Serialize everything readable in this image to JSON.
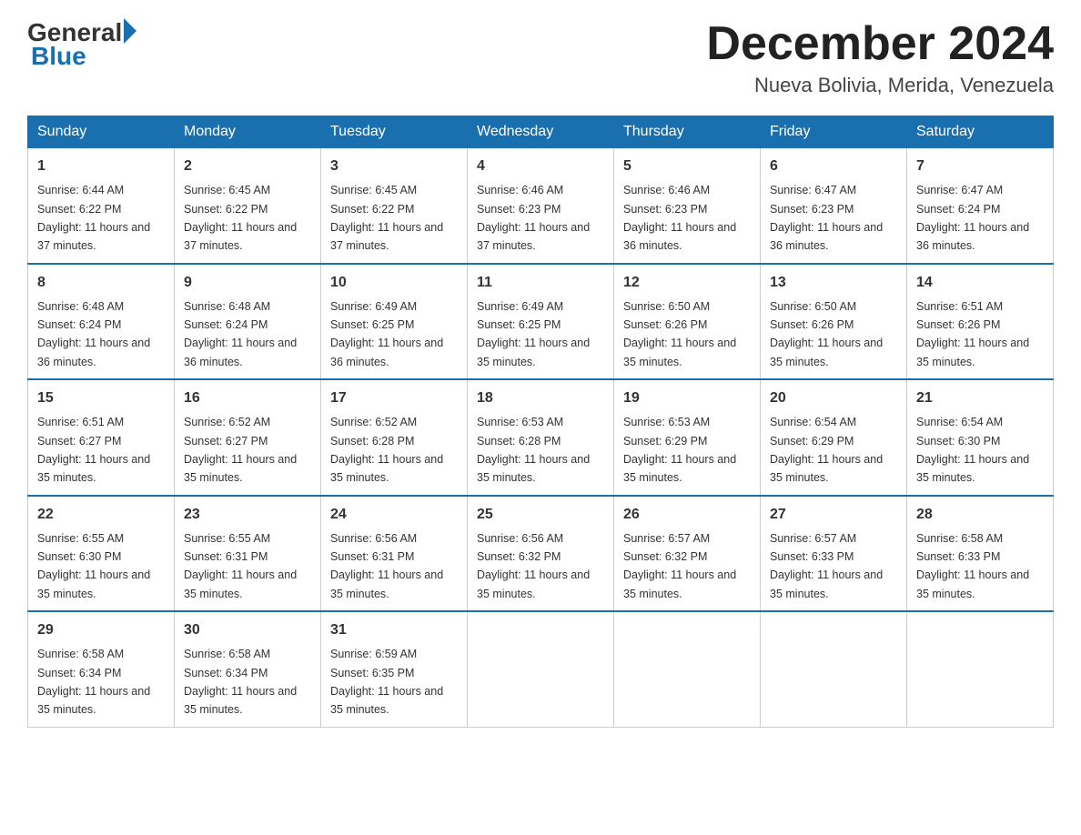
{
  "header": {
    "logo": {
      "general": "General",
      "arrow": "▶",
      "blue": "Blue"
    },
    "title": "December 2024",
    "location": "Nueva Bolivia, Merida, Venezuela"
  },
  "calendar": {
    "days_of_week": [
      "Sunday",
      "Monday",
      "Tuesday",
      "Wednesday",
      "Thursday",
      "Friday",
      "Saturday"
    ],
    "weeks": [
      [
        {
          "day": "1",
          "sunrise": "6:44 AM",
          "sunset": "6:22 PM",
          "daylight": "11 hours and 37 minutes."
        },
        {
          "day": "2",
          "sunrise": "6:45 AM",
          "sunset": "6:22 PM",
          "daylight": "11 hours and 37 minutes."
        },
        {
          "day": "3",
          "sunrise": "6:45 AM",
          "sunset": "6:22 PM",
          "daylight": "11 hours and 37 minutes."
        },
        {
          "day": "4",
          "sunrise": "6:46 AM",
          "sunset": "6:23 PM",
          "daylight": "11 hours and 37 minutes."
        },
        {
          "day": "5",
          "sunrise": "6:46 AM",
          "sunset": "6:23 PM",
          "daylight": "11 hours and 36 minutes."
        },
        {
          "day": "6",
          "sunrise": "6:47 AM",
          "sunset": "6:23 PM",
          "daylight": "11 hours and 36 minutes."
        },
        {
          "day": "7",
          "sunrise": "6:47 AM",
          "sunset": "6:24 PM",
          "daylight": "11 hours and 36 minutes."
        }
      ],
      [
        {
          "day": "8",
          "sunrise": "6:48 AM",
          "sunset": "6:24 PM",
          "daylight": "11 hours and 36 minutes."
        },
        {
          "day": "9",
          "sunrise": "6:48 AM",
          "sunset": "6:24 PM",
          "daylight": "11 hours and 36 minutes."
        },
        {
          "day": "10",
          "sunrise": "6:49 AM",
          "sunset": "6:25 PM",
          "daylight": "11 hours and 36 minutes."
        },
        {
          "day": "11",
          "sunrise": "6:49 AM",
          "sunset": "6:25 PM",
          "daylight": "11 hours and 35 minutes."
        },
        {
          "day": "12",
          "sunrise": "6:50 AM",
          "sunset": "6:26 PM",
          "daylight": "11 hours and 35 minutes."
        },
        {
          "day": "13",
          "sunrise": "6:50 AM",
          "sunset": "6:26 PM",
          "daylight": "11 hours and 35 minutes."
        },
        {
          "day": "14",
          "sunrise": "6:51 AM",
          "sunset": "6:26 PM",
          "daylight": "11 hours and 35 minutes."
        }
      ],
      [
        {
          "day": "15",
          "sunrise": "6:51 AM",
          "sunset": "6:27 PM",
          "daylight": "11 hours and 35 minutes."
        },
        {
          "day": "16",
          "sunrise": "6:52 AM",
          "sunset": "6:27 PM",
          "daylight": "11 hours and 35 minutes."
        },
        {
          "day": "17",
          "sunrise": "6:52 AM",
          "sunset": "6:28 PM",
          "daylight": "11 hours and 35 minutes."
        },
        {
          "day": "18",
          "sunrise": "6:53 AM",
          "sunset": "6:28 PM",
          "daylight": "11 hours and 35 minutes."
        },
        {
          "day": "19",
          "sunrise": "6:53 AM",
          "sunset": "6:29 PM",
          "daylight": "11 hours and 35 minutes."
        },
        {
          "day": "20",
          "sunrise": "6:54 AM",
          "sunset": "6:29 PM",
          "daylight": "11 hours and 35 minutes."
        },
        {
          "day": "21",
          "sunrise": "6:54 AM",
          "sunset": "6:30 PM",
          "daylight": "11 hours and 35 minutes."
        }
      ],
      [
        {
          "day": "22",
          "sunrise": "6:55 AM",
          "sunset": "6:30 PM",
          "daylight": "11 hours and 35 minutes."
        },
        {
          "day": "23",
          "sunrise": "6:55 AM",
          "sunset": "6:31 PM",
          "daylight": "11 hours and 35 minutes."
        },
        {
          "day": "24",
          "sunrise": "6:56 AM",
          "sunset": "6:31 PM",
          "daylight": "11 hours and 35 minutes."
        },
        {
          "day": "25",
          "sunrise": "6:56 AM",
          "sunset": "6:32 PM",
          "daylight": "11 hours and 35 minutes."
        },
        {
          "day": "26",
          "sunrise": "6:57 AM",
          "sunset": "6:32 PM",
          "daylight": "11 hours and 35 minutes."
        },
        {
          "day": "27",
          "sunrise": "6:57 AM",
          "sunset": "6:33 PM",
          "daylight": "11 hours and 35 minutes."
        },
        {
          "day": "28",
          "sunrise": "6:58 AM",
          "sunset": "6:33 PM",
          "daylight": "11 hours and 35 minutes."
        }
      ],
      [
        {
          "day": "29",
          "sunrise": "6:58 AM",
          "sunset": "6:34 PM",
          "daylight": "11 hours and 35 minutes."
        },
        {
          "day": "30",
          "sunrise": "6:58 AM",
          "sunset": "6:34 PM",
          "daylight": "11 hours and 35 minutes."
        },
        {
          "day": "31",
          "sunrise": "6:59 AM",
          "sunset": "6:35 PM",
          "daylight": "11 hours and 35 minutes."
        },
        null,
        null,
        null,
        null
      ]
    ]
  }
}
